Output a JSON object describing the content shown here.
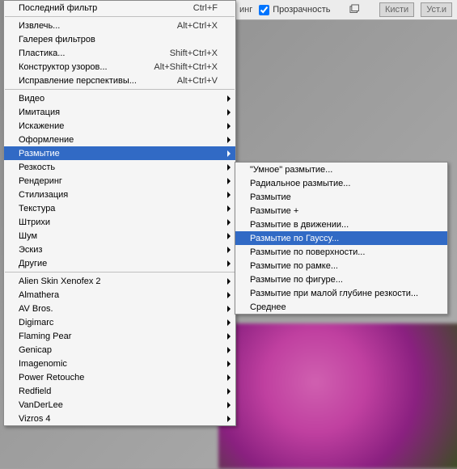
{
  "toolbar": {
    "label_end": "инг",
    "chk_label": "Прозрачность",
    "chk": true,
    "tab1": "Кисти",
    "tab2": "Уст.и"
  },
  "menu": {
    "top": {
      "label": "Последний фильтр",
      "shortcut": "Ctrl+F"
    },
    "g1": [
      {
        "label": "Извлечь...",
        "shortcut": "Alt+Ctrl+X"
      },
      {
        "label": "Галерея фильтров",
        "shortcut": ""
      },
      {
        "label": "Пластика...",
        "shortcut": "Shift+Ctrl+X"
      },
      {
        "label": "Конструктор узоров...",
        "shortcut": "Alt+Shift+Ctrl+X"
      },
      {
        "label": "Исправление перспективы...",
        "shortcut": "Alt+Ctrl+V"
      }
    ],
    "g2": [
      {
        "label": "Видео",
        "sub": true
      },
      {
        "label": "Имитация",
        "sub": true
      },
      {
        "label": "Искажение",
        "sub": true
      },
      {
        "label": "Оформление",
        "sub": true
      },
      {
        "label": "Размытие",
        "sub": true,
        "hl": true
      },
      {
        "label": "Резкость",
        "sub": true
      },
      {
        "label": "Рендеринг",
        "sub": true
      },
      {
        "label": "Стилизация",
        "sub": true
      },
      {
        "label": "Текстура",
        "sub": true
      },
      {
        "label": "Штрихи",
        "sub": true
      },
      {
        "label": "Шум",
        "sub": true
      },
      {
        "label": "Эскиз",
        "sub": true
      },
      {
        "label": "Другие",
        "sub": true
      }
    ],
    "g3": [
      {
        "label": "Alien Skin Xenofex 2",
        "sub": true
      },
      {
        "label": "Almathera",
        "sub": true
      },
      {
        "label": "AV Bros.",
        "sub": true
      },
      {
        "label": "Digimarc",
        "sub": true
      },
      {
        "label": "Flaming Pear",
        "sub": true
      },
      {
        "label": "Genicap",
        "sub": true
      },
      {
        "label": "Imagenomic",
        "sub": true
      },
      {
        "label": "Power Retouche",
        "sub": true
      },
      {
        "label": "Redfield",
        "sub": true
      },
      {
        "label": "VanDerLee",
        "sub": true
      },
      {
        "label": "Vizros 4",
        "sub": true
      }
    ]
  },
  "submenu": [
    {
      "label": "\"Умное\" размытие..."
    },
    {
      "label": "Радиальное размытие..."
    },
    {
      "label": "Размытие"
    },
    {
      "label": "Размытие +"
    },
    {
      "label": "Размытие в движении..."
    },
    {
      "label": "Размытие по Гауссу...",
      "hl": true
    },
    {
      "label": "Размытие по поверхности..."
    },
    {
      "label": "Размытие по рамке..."
    },
    {
      "label": "Размытие по фигуре..."
    },
    {
      "label": "Размытие при малой глубине резкости..."
    },
    {
      "label": "Среднее"
    }
  ]
}
